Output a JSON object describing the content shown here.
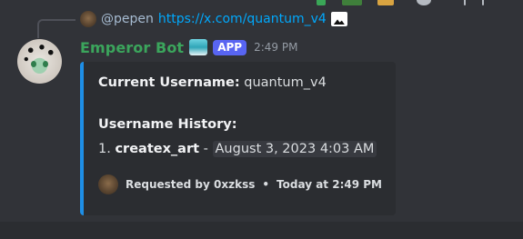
{
  "colors": {
    "background": "#313338",
    "embed_bg": "#2b2d31",
    "embed_accent": "#1e8ee6",
    "username": "#3ba55c",
    "link": "#00a8fc",
    "badge": "#5865f2"
  },
  "reply": {
    "author": "@pepen",
    "content": "https://x.com/quantum_v4"
  },
  "message": {
    "author": "Emperor Bot",
    "badge": "APP",
    "time": "2:49 PM"
  },
  "embed": {
    "current_label": "Current Username:",
    "current_value": "quantum_v4",
    "history_label": "Username History:",
    "history": [
      {
        "index": "1.",
        "name": "createx_art",
        "separator": "-",
        "date": "August 3, 2023 4:03 AM"
      }
    ],
    "footer_text": "Requested by 0xzkss",
    "footer_dot": "•",
    "footer_time": "Today at 2:49 PM"
  }
}
